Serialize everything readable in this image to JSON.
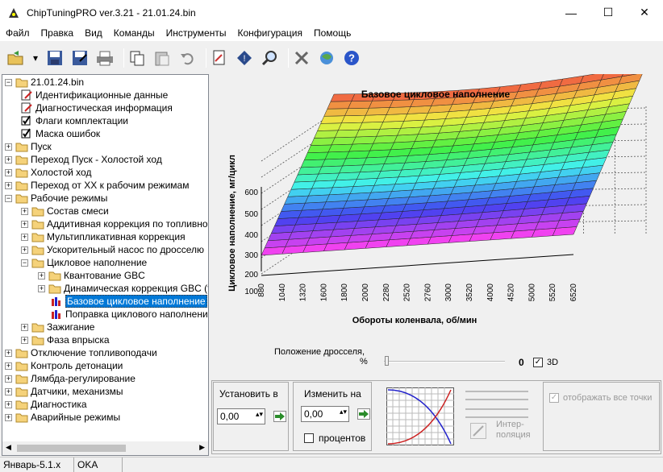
{
  "window": {
    "title": "ChipTuningPRO ver.3.21 - 21.01.24.bin"
  },
  "menu": [
    "Файл",
    "Правка",
    "Вид",
    "Команды",
    "Инструменты",
    "Конфигурация",
    "Помощь"
  ],
  "tree": {
    "root": "21.01.24.bin",
    "items": [
      "Идентификационные данные",
      "Диагностическая информация",
      "Флаги комплектации",
      "Маска ошибок",
      "Пуск",
      "Переход Пуск - Холостой ход",
      "Холостой ход",
      "Переход от ХХ к рабочим режимам",
      "Рабочие режимы",
      "Состав смеси",
      "Аддитивная коррекция по топливной п",
      "Мультипликативная коррекция",
      "Ускорительный насос по дросселю",
      "Цикловое наполнение",
      "Квантование GBC",
      "Динамическая коррекция GBC (тс",
      "Базовое цикловое наполнение",
      "Поправка циклового наполнения",
      "Зажигание",
      "Фаза впрыска",
      "Отключение топливоподачи",
      "Контроль детонации",
      "Лямбда-регулирование",
      "Датчики, механизмы",
      "Диагностика",
      "Аварийные режимы"
    ]
  },
  "chart_data": {
    "type": "surface-3d",
    "title": "Базовое цикловое наполнение",
    "xlabel": "Обороты коленвала, об/мин",
    "ylabel": "Цикловое наполнение, мг/цикл",
    "x": [
      880,
      1040,
      1320,
      1600,
      1800,
      2000,
      2280,
      2520,
      2760,
      3000,
      3520,
      4000,
      4520,
      5000,
      5520,
      6520
    ],
    "y_ticks": [
      100,
      200,
      300,
      400,
      500,
      600
    ],
    "ylim": [
      100,
      600
    ],
    "view": "3d"
  },
  "throttle": {
    "label": "Положение дросселя,",
    "unit": "%",
    "value": "0",
    "checkbox_3d": "3D"
  },
  "controls": {
    "set_label": "Установить в",
    "set_value": "0,00",
    "change_label": "Изменить на",
    "change_value": "0,00",
    "percent_label": "процентов",
    "interp_label": "Интер-\nполяция",
    "show_all_label": "отображать все точки"
  },
  "status": {
    "left": "Январь-5.1.x",
    "mid": "OKA"
  },
  "colors": {
    "selection": "#0078d7"
  }
}
